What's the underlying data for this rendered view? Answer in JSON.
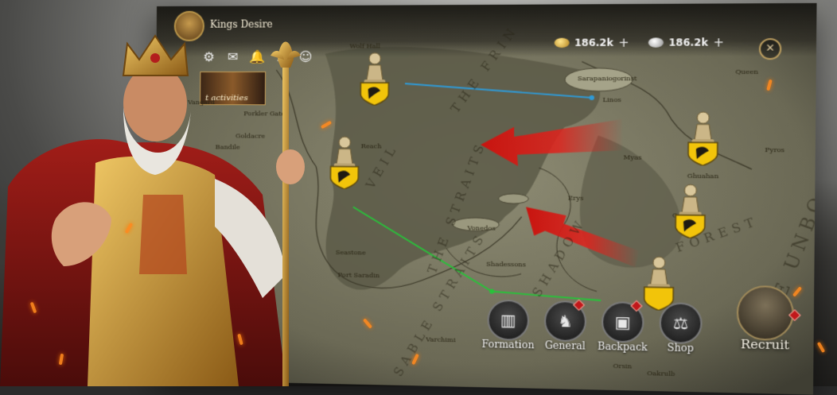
{
  "header": {
    "game_title": "Kings Desire"
  },
  "resources": [
    {
      "name": "gold",
      "amount": "186.2k",
      "plus": "+"
    },
    {
      "name": "silver",
      "amount": "186.2k",
      "plus": "+"
    }
  ],
  "close": {
    "glyph": "✕"
  },
  "top_icons": [
    {
      "name": "settings-icon",
      "glyph": "⚙"
    },
    {
      "name": "mail-icon",
      "glyph": "✉"
    },
    {
      "name": "bell-icon",
      "glyph": "🔔"
    },
    {
      "name": "castle-icon",
      "glyph": "♜"
    },
    {
      "name": "friends-icon",
      "glyph": "☺"
    }
  ],
  "event_banner": {
    "label": "t activities"
  },
  "map": {
    "places": [
      "Wolf Hall",
      "Sarapaniogorinst",
      "Linos",
      "Queen",
      "Goldacre",
      "Porkler Gate",
      "Reach",
      "Myas",
      "Ghuahan",
      "Pyros",
      "Erys",
      "Qoruh",
      "Vonedos",
      "Shadessons",
      "Seastone",
      "Port Saradin",
      "Varchimi",
      "Orsin",
      "Oakrulb",
      "Vangard",
      "Bandile"
    ],
    "regions": [
      "THE FRIN",
      "THE STRAITS",
      "VEIL",
      "SHADOW",
      "FOREST",
      "THE UNBO",
      "SABLE STRAITS"
    ]
  },
  "bottom_bar": {
    "formation": "Formation",
    "general": "General",
    "backpack": "Backpack",
    "shop": "Shop",
    "recruit": "Recruit"
  },
  "colors": {
    "attack_arrow": "#e0221c",
    "route_blue": "#2f9ad6",
    "route_green": "#28c23a",
    "shield": "#f2c40a"
  }
}
